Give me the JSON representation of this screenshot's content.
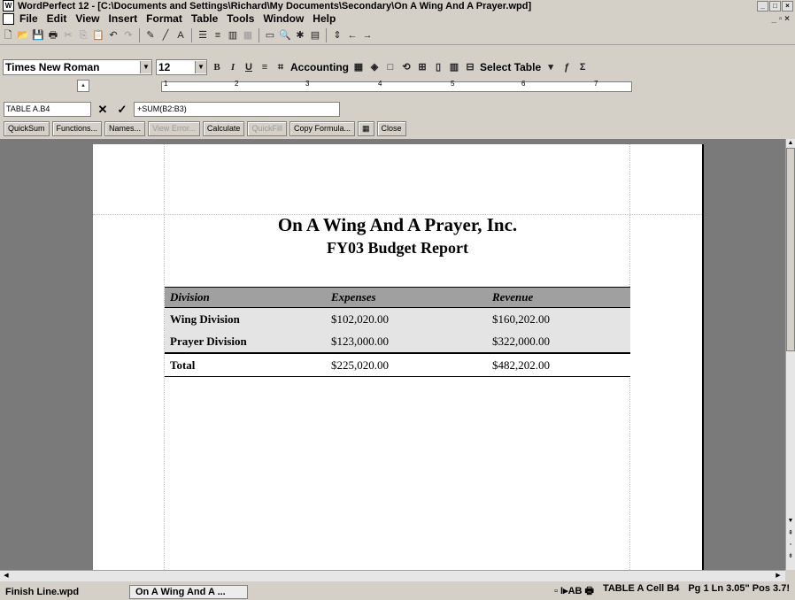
{
  "window": {
    "title": "WordPerfect 12 - [C:\\Documents and Settings\\Richard\\My Documents\\Secondary\\On A Wing And A Prayer.wpd]"
  },
  "menu": [
    "File",
    "Edit",
    "View",
    "Insert",
    "Format",
    "Table",
    "Tools",
    "Window",
    "Help"
  ],
  "property_bar": {
    "font": "Times New Roman",
    "size": "12",
    "accounting_label": "Accounting",
    "select_table_label": "Select Table"
  },
  "formula_bar": {
    "cell_name": "TABLE A.B4",
    "formula": "+SUM(B2:B3)",
    "buttons": [
      "QuickSum",
      "Functions...",
      "Names...",
      "View Error...",
      "Calculate",
      "QuickFill",
      "Copy Formula...",
      "Close"
    ]
  },
  "ruler": {
    "numbers": [
      "1",
      "2",
      "3",
      "4",
      "5",
      "6",
      "7"
    ]
  },
  "document": {
    "title": "On A Wing And A Prayer, Inc.",
    "subtitle": "FY03 Budget Report",
    "table": {
      "headers": [
        "Division",
        "Expenses",
        "Revenue"
      ],
      "rows": [
        [
          "Wing Division",
          "$102,020.00",
          "$160,202.00"
        ],
        [
          "Prayer Division",
          "$123,000.00",
          "$322,000.00"
        ],
        [
          "Total",
          "$225,020.00",
          "$482,202.00"
        ]
      ]
    }
  },
  "status": {
    "file": "Finish Line.wpd",
    "tab": "On A Wing And A ...",
    "cell": "TABLE A Cell  B4",
    "position": "Pg 1 Ln 3.05\" Pos 3.7!"
  }
}
